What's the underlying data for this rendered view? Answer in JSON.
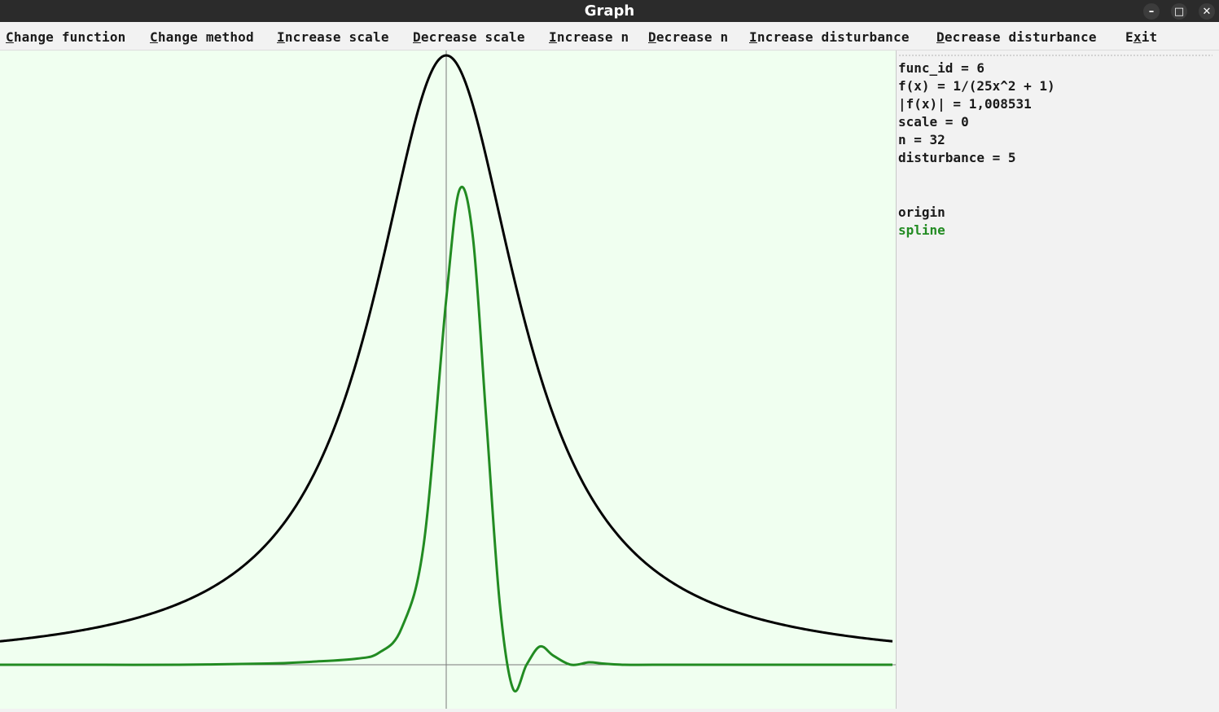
{
  "window": {
    "title": "Graph",
    "minimize_icon": "minimize-icon",
    "maximize_icon": "maximize-icon",
    "close_icon": "close-icon"
  },
  "menu": {
    "change_function": "Change function",
    "change_method": "Change method",
    "increase_scale": "Increase scale",
    "decrease_scale": "Decrease scale",
    "increase_n": "Increase n",
    "decrease_n": "Decrease n",
    "increase_disturbance": "Increase disturbance",
    "decrease_disturbance": "Decrease disturbance",
    "exit": "Exit"
  },
  "info": {
    "func_id": "func_id = 6",
    "formula": "f(x) = 1/(25x^2 + 1)",
    "norm": "|f(x)| = 1,008531",
    "scale": "scale = 0",
    "n": "n = 32",
    "disturbance": "disturbance = 5"
  },
  "legend": {
    "origin": "origin",
    "spline": "spline"
  },
  "colors": {
    "origin": "#000000",
    "spline": "#228b22",
    "plot_background": "#f0fff0",
    "axes": "#7a7a7a"
  },
  "chart_data": {
    "type": "line",
    "title": "",
    "xlabel": "",
    "ylabel": "",
    "xlim": [
      -1,
      1
    ],
    "ylim": [
      -0.06,
      1.0
    ],
    "grid": false,
    "series": [
      {
        "name": "origin",
        "function": "1/(25x^2 + 1)",
        "x": [
          -1.0,
          -0.8,
          -0.6,
          -0.4,
          -0.3,
          -0.2,
          -0.15,
          -0.1,
          -0.05,
          0.0,
          0.05,
          0.1,
          0.15,
          0.2,
          0.3,
          0.4,
          0.6,
          0.8,
          1.0
        ],
        "y": [
          0.038,
          0.059,
          0.1,
          0.2,
          0.308,
          0.5,
          0.64,
          0.8,
          0.941,
          1.0,
          0.941,
          0.8,
          0.64,
          0.5,
          0.308,
          0.2,
          0.1,
          0.059,
          0.038
        ]
      },
      {
        "name": "spline",
        "x": [
          -1.0,
          -0.8,
          -0.6,
          -0.4,
          -0.3,
          -0.2,
          -0.15,
          -0.1,
          -0.05,
          0.0,
          0.03,
          0.06,
          0.09,
          0.12,
          0.15,
          0.18,
          0.21,
          0.24,
          0.28,
          0.32,
          0.35,
          0.4,
          0.5,
          0.6,
          0.8,
          1.0
        ],
        "y": [
          0.0,
          0.0,
          0.0,
          0.002,
          0.005,
          0.01,
          0.02,
          0.06,
          0.2,
          0.6,
          0.78,
          0.7,
          0.4,
          0.1,
          -0.04,
          0.0,
          0.03,
          0.015,
          0.0,
          0.004,
          0.002,
          0.0,
          0.0,
          0.0,
          0.0,
          0.0
        ]
      }
    ]
  }
}
